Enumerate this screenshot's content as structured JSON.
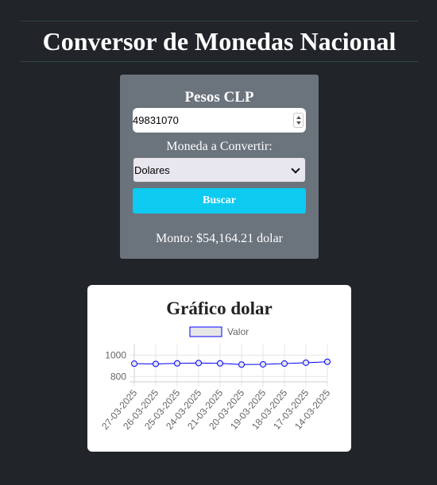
{
  "header": {
    "title": "Conversor de Monedas Nacional"
  },
  "converter": {
    "pesos_label": "Pesos CLP",
    "amount_value": "49831070",
    "currency_label": "Moneda a Convertir:",
    "currency_selected": "Dolares",
    "search_button_label": "Buscar",
    "result_text": "Monto: $54,164.21 dolar"
  },
  "colors": {
    "background": "#212429",
    "card": "#6b737d",
    "button": "#0dcaf0",
    "series_line": "#0000ff"
  },
  "chart_data": {
    "type": "line",
    "title": "Gráfico dolar",
    "legend_position": "top",
    "grid": true,
    "categories": [
      "27-03-2025",
      "26-03-2025",
      "25-03-2025",
      "24-03-2025",
      "21-03-2025",
      "20-03-2025",
      "19-03-2025",
      "18-03-2025",
      "17-03-2025",
      "14-03-2025"
    ],
    "series": [
      {
        "name": "Valor",
        "values": [
          920,
          918,
          923,
          926,
          923,
          912,
          914,
          921,
          929,
          938
        ]
      }
    ],
    "ylim": [
      750,
      1100
    ],
    "yticks": [
      "1000",
      "800"
    ],
    "ytick_values": [
      1000,
      800
    ]
  }
}
